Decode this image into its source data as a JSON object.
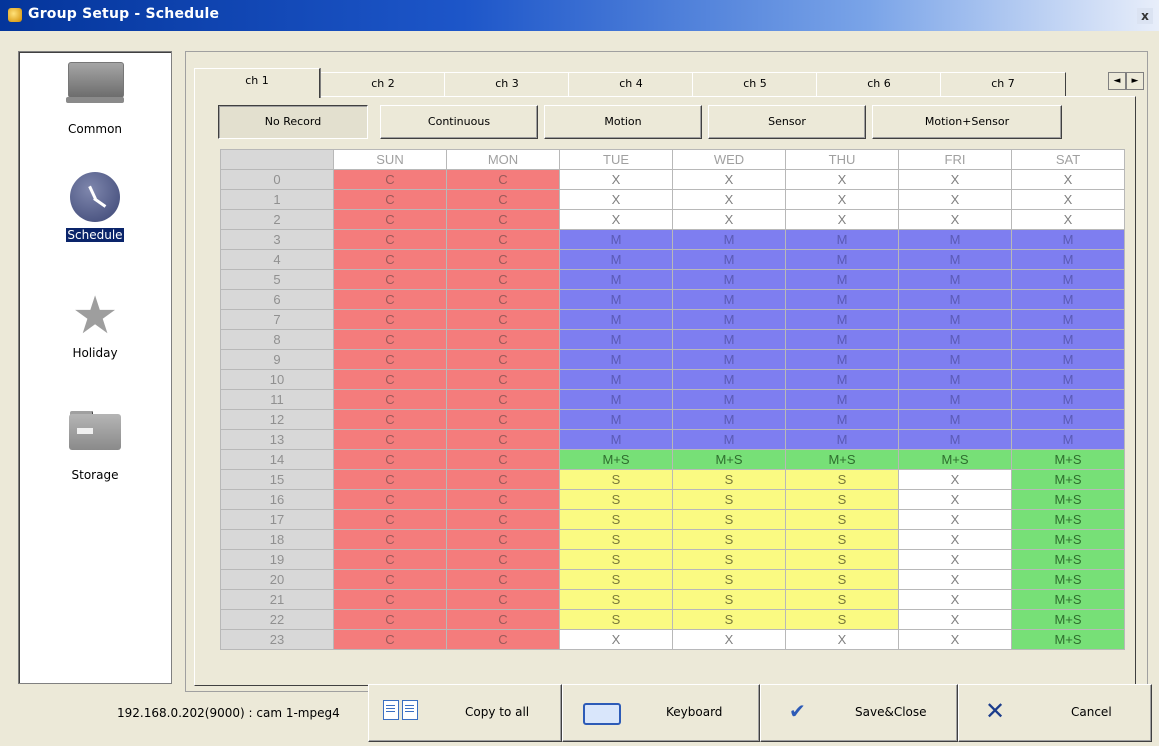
{
  "window": {
    "title": "Group Setup - Schedule",
    "close_glyph": "x"
  },
  "sidebar": {
    "items": [
      {
        "label": "Common",
        "icon": "monitor-icon",
        "selected": false
      },
      {
        "label": "Schedule",
        "icon": "clock-icon",
        "selected": true
      },
      {
        "label": "Holiday",
        "icon": "star-icon",
        "selected": false
      },
      {
        "label": "Storage",
        "icon": "folder-icon",
        "selected": false
      }
    ]
  },
  "tabs": {
    "labels": [
      "ch 1",
      "ch 2",
      "ch 3",
      "ch 4",
      "ch 5",
      "ch 6",
      "ch 7"
    ],
    "active": 0,
    "scroll_left": "◄",
    "scroll_right": "►"
  },
  "modes": {
    "labels": [
      "No Record",
      "Continuous",
      "Motion",
      "Sensor",
      "Motion+Sensor"
    ],
    "pressed": 0
  },
  "schedule": {
    "days": [
      "SUN",
      "MON",
      "TUE",
      "WED",
      "THU",
      "FRI",
      "SAT"
    ],
    "hours": [
      "0",
      "1",
      "2",
      "3",
      "4",
      "5",
      "6",
      "7",
      "8",
      "9",
      "10",
      "11",
      "12",
      "13",
      "14",
      "15",
      "16",
      "17",
      "18",
      "19",
      "20",
      "21",
      "22",
      "23"
    ],
    "rows": [
      [
        "C",
        "C",
        "X",
        "X",
        "X",
        "X",
        "X"
      ],
      [
        "C",
        "C",
        "X",
        "X",
        "X",
        "X",
        "X"
      ],
      [
        "C",
        "C",
        "X",
        "X",
        "X",
        "X",
        "X"
      ],
      [
        "C",
        "C",
        "M",
        "M",
        "M",
        "M",
        "M"
      ],
      [
        "C",
        "C",
        "M",
        "M",
        "M",
        "M",
        "M"
      ],
      [
        "C",
        "C",
        "M",
        "M",
        "M",
        "M",
        "M"
      ],
      [
        "C",
        "C",
        "M",
        "M",
        "M",
        "M",
        "M"
      ],
      [
        "C",
        "C",
        "M",
        "M",
        "M",
        "M",
        "M"
      ],
      [
        "C",
        "C",
        "M",
        "M",
        "M",
        "M",
        "M"
      ],
      [
        "C",
        "C",
        "M",
        "M",
        "M",
        "M",
        "M"
      ],
      [
        "C",
        "C",
        "M",
        "M",
        "M",
        "M",
        "M"
      ],
      [
        "C",
        "C",
        "M",
        "M",
        "M",
        "M",
        "M"
      ],
      [
        "C",
        "C",
        "M",
        "M",
        "M",
        "M",
        "M"
      ],
      [
        "C",
        "C",
        "M",
        "M",
        "M",
        "M",
        "M"
      ],
      [
        "C",
        "C",
        "M+S",
        "M+S",
        "M+S",
        "M+S",
        "M+S"
      ],
      [
        "C",
        "C",
        "S",
        "S",
        "S",
        "X",
        "M+S"
      ],
      [
        "C",
        "C",
        "S",
        "S",
        "S",
        "X",
        "M+S"
      ],
      [
        "C",
        "C",
        "S",
        "S",
        "S",
        "X",
        "M+S"
      ],
      [
        "C",
        "C",
        "S",
        "S",
        "S",
        "X",
        "M+S"
      ],
      [
        "C",
        "C",
        "S",
        "S",
        "S",
        "X",
        "M+S"
      ],
      [
        "C",
        "C",
        "S",
        "S",
        "S",
        "X",
        "M+S"
      ],
      [
        "C",
        "C",
        "S",
        "S",
        "S",
        "X",
        "M+S"
      ],
      [
        "C",
        "C",
        "S",
        "S",
        "S",
        "X",
        "M+S"
      ],
      [
        "C",
        "C",
        "X",
        "X",
        "X",
        "X",
        "M+S"
      ]
    ],
    "colors": {
      "C": "#f47c7c",
      "X": "#ffffff",
      "M": "#7e7ef0",
      "M+S": "#77e077",
      "S": "#fafa82"
    }
  },
  "footer": {
    "status": "192.168.0.202(9000) : cam 1-mpeg4",
    "copy_label": "Copy to all",
    "keyboard_label": "Keyboard",
    "save_label": "Save&Close",
    "cancel_label": "Cancel"
  }
}
